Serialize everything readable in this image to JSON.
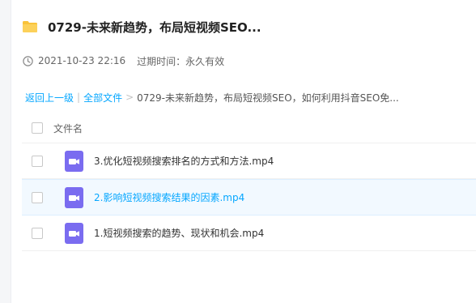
{
  "header": {
    "title": "0729-未来新趋势，布局短视频SEO...",
    "folder_icon": "folder-icon"
  },
  "meta": {
    "date": "2021-10-23 22:16",
    "expire_text": "过期时间：永久有效",
    "clock_icon": "clock-icon"
  },
  "breadcrumb": {
    "back": "返回上一级",
    "separator": "|",
    "all_files": "全部文件",
    "arrow": ">",
    "current": "0729-未来新趋势，布局短视频SEO，如何利用抖音SEO免..."
  },
  "table": {
    "header_name": "文件名",
    "files": [
      {
        "name": "3.优化短视频搜索排名的方式和方法.mp4",
        "icon": "video-file-icon",
        "selected": false
      },
      {
        "name": "2.影响短视频搜索结果的因素.mp4",
        "icon": "video-file-icon",
        "selected": false,
        "hover": true
      },
      {
        "name": "1.短视频搜索的趋势、现状和机会.mp4",
        "icon": "video-file-icon",
        "selected": false
      }
    ]
  },
  "colors": {
    "accent": "#06a7ff",
    "folder": "#f9c33a",
    "video_icon": "#7a6cf0",
    "hover_row": "#f2f9ff"
  }
}
